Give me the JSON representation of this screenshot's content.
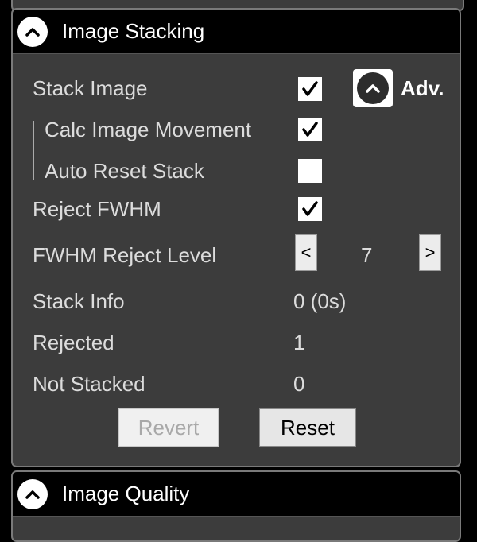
{
  "panels": {
    "stacking": {
      "title": "Image Stacking",
      "adv_label": "Adv.",
      "stack_image": {
        "label": "Stack Image",
        "checked": true
      },
      "calc_image_movement": {
        "label": "Calc Image Movement",
        "checked": true
      },
      "auto_reset_stack": {
        "label": "Auto Reset Stack",
        "checked": false
      },
      "reject_fwhm": {
        "label": "Reject FWHM",
        "checked": true
      },
      "fwhm_reject_level": {
        "label": "FWHM Reject Level",
        "value": "7",
        "decrement": "<",
        "increment": ">"
      },
      "stack_info": {
        "label": "Stack Info",
        "value": "0 (0s)"
      },
      "rejected": {
        "label": "Rejected",
        "value": "1"
      },
      "not_stacked": {
        "label": "Not Stacked",
        "value": "0"
      },
      "revert_label": "Revert",
      "reset_label": "Reset"
    },
    "quality": {
      "title": "Image Quality"
    }
  },
  "colors": {
    "panel_bg": "#3c3c3c",
    "header_bg": "#000000",
    "border": "#7a7a7a",
    "text": "#dcdcdc"
  },
  "icons": [
    "chevron-up-icon",
    "check-icon"
  ]
}
